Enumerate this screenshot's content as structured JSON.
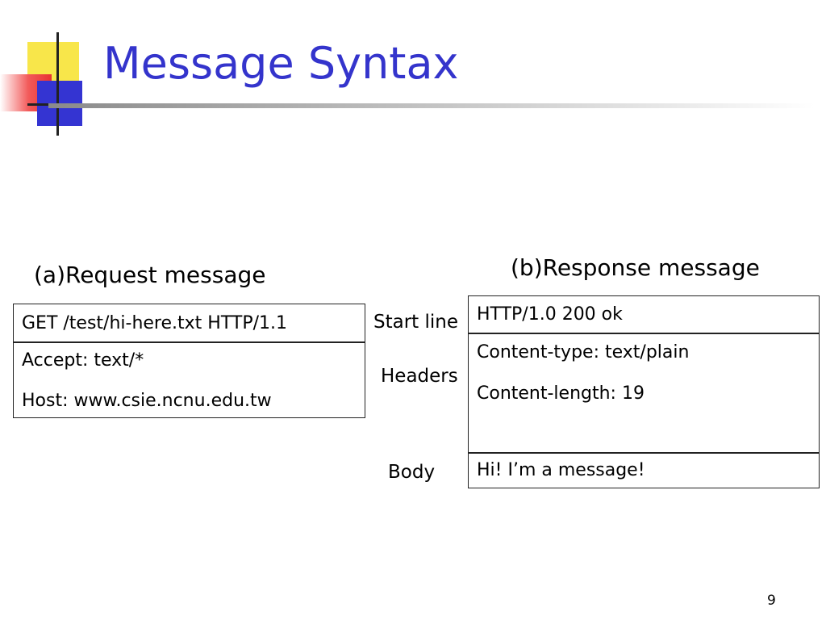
{
  "slide": {
    "title": "Message Syntax",
    "page_number": "9"
  },
  "request": {
    "caption": "(a)Request message",
    "start_line": "GET /test/hi-here.txt HTTP/1.1",
    "headers": [
      "Accept: text/*",
      "Host: www.csie.ncnu.edu.tw"
    ]
  },
  "response": {
    "caption": "(b)Response message",
    "start_line": "HTTP/1.0 200 ok",
    "headers": [
      "Content-type: text/plain",
      "Content-length: 19"
    ],
    "body": "Hi! I’m a message!"
  },
  "labels": {
    "start_line": "Start line",
    "headers": "Headers",
    "body": "Body"
  },
  "colors": {
    "title": "#3434cc",
    "logo_yellow": "#f8e64a",
    "logo_red": "#e83232",
    "logo_blue": "#3434d2"
  }
}
